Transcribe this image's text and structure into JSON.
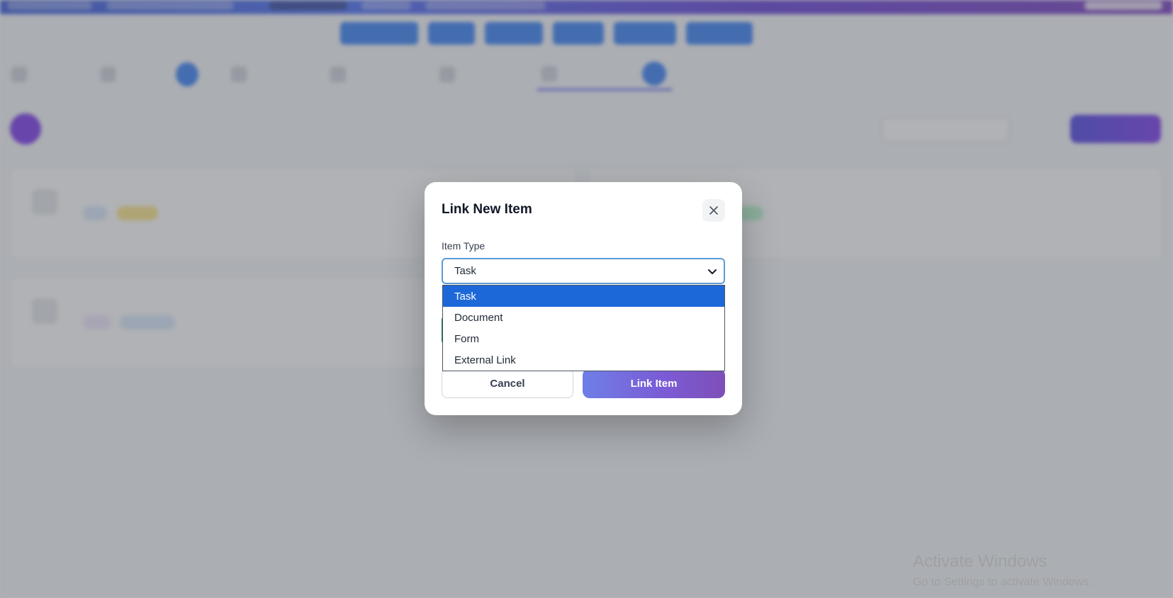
{
  "modal": {
    "title": "Link New Item",
    "item_type_label": "Item Type",
    "selected_value": "Task",
    "options": [
      "Task",
      "Document",
      "Form",
      "External Link"
    ],
    "highlighted_option": "Task",
    "cancel_label": "Cancel",
    "submit_label": "Link Item"
  },
  "watermark": {
    "line1": "Activate Windows",
    "line2": "Go to Settings to activate Windows."
  },
  "colors": {
    "accent": "#1d68d8",
    "submit_gradient_start": "#6e7fe6",
    "submit_gradient_end": "#7e4fb8",
    "overlay": "#50545a"
  },
  "icons": {
    "close": "close-icon",
    "select_arrow": "chevron-down-icon"
  }
}
